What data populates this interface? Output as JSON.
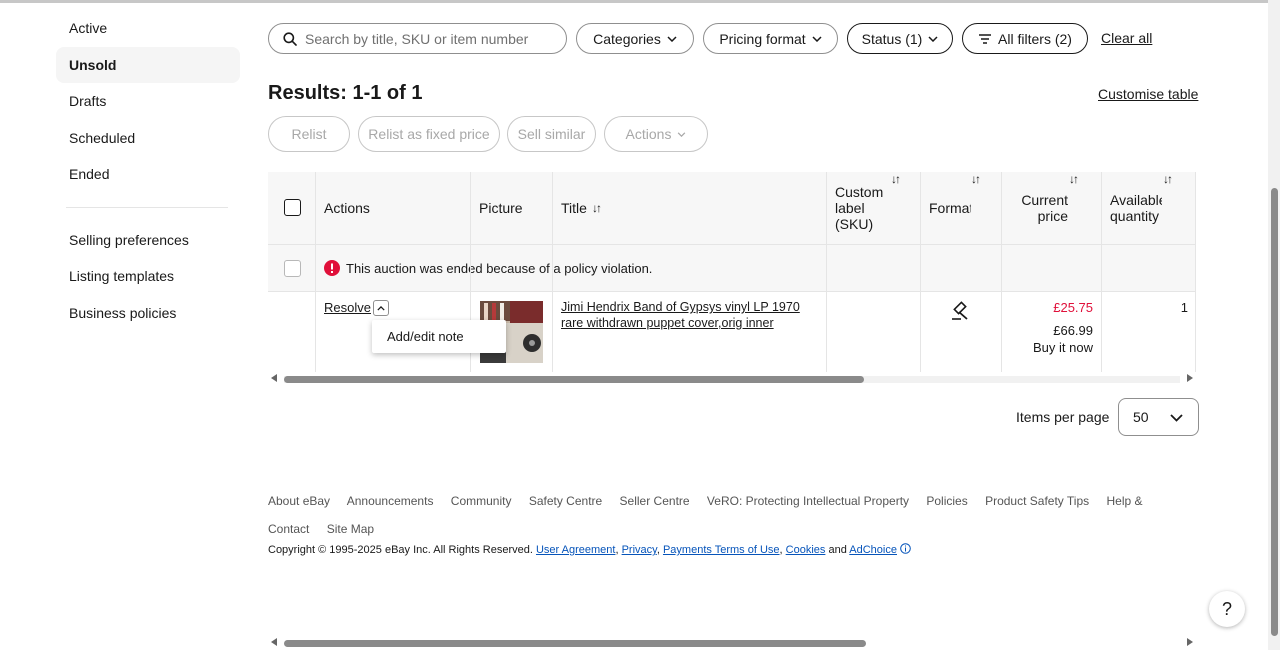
{
  "sidebar": {
    "items": [
      {
        "label": "Active"
      },
      {
        "label": "Unsold"
      },
      {
        "label": "Drafts"
      },
      {
        "label": "Scheduled"
      },
      {
        "label": "Ended"
      }
    ],
    "settings": [
      {
        "label": "Selling preferences"
      },
      {
        "label": "Listing templates"
      },
      {
        "label": "Business policies"
      }
    ]
  },
  "filters": {
    "search_placeholder": "Search by title, SKU or item number",
    "categories": "Categories",
    "pricing_format": "Pricing format",
    "status": "Status (1)",
    "all_filters": "All filters (2)",
    "clear_all": "Clear all"
  },
  "results": {
    "summary": "Results: 1-1 of 1",
    "customise": "Customise table"
  },
  "bulk_actions": {
    "relist": "Relist",
    "relist_fixed": "Relist as fixed price",
    "sell_similar": "Sell similar",
    "actions": "Actions"
  },
  "table": {
    "headers": {
      "actions": "Actions",
      "picture": "Picture",
      "title": "Title",
      "custom_label": "Custom label (SKU)",
      "format": "Format",
      "current_price": "Current price",
      "available_quantity": "Available quantity"
    },
    "policy_message": "This auction was ended because of a policy violation.",
    "row": {
      "action": "Resolve",
      "menu_item": "Add/edit note",
      "title": "Jimi Hendrix Band of Gypsys vinyl LP 1970 rare withdrawn puppet cover,orig inner",
      "current_price": "£25.75",
      "buy_it_now_price": "£66.99",
      "buy_it_now_label": "Buy it now",
      "quantity": "1"
    }
  },
  "pagination": {
    "items_per_page_label": "Items per page",
    "items_per_page_value": "50"
  },
  "footer": {
    "links": [
      "About eBay",
      "Announcements",
      "Community",
      "Safety Centre",
      "Seller Centre",
      "VeRO: Protecting Intellectual Property",
      "Policies",
      "Product Safety Tips",
      "Help & Contact",
      "Site Map"
    ],
    "copyright_prefix": "Copyright © 1995-2025 eBay Inc. All Rights Reserved.",
    "user_agreement": "User Agreement",
    "privacy": "Privacy",
    "payments_terms": "Payments Terms of Use",
    "cookies": "Cookies",
    "and": "and",
    "adchoice": "AdChoice"
  },
  "help": {
    "label": "?"
  },
  "colors": {
    "price_red": "#e0103a",
    "error_red": "#e0103a",
    "link_blue": "#0654ba"
  }
}
